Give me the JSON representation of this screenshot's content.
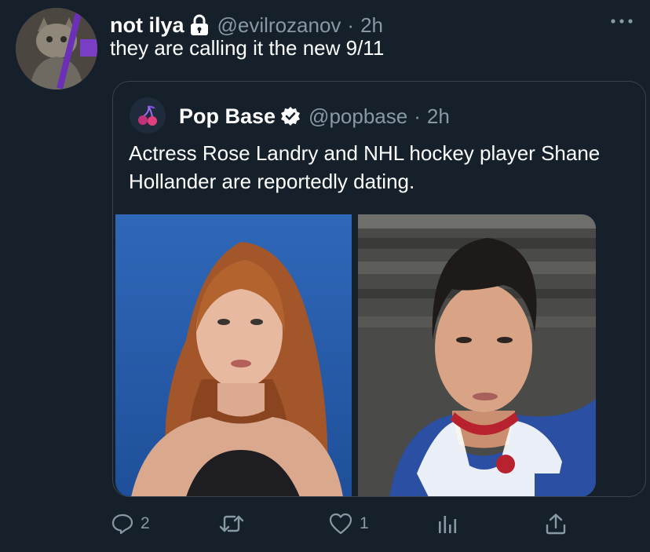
{
  "tweet": {
    "display_name": "not ilya",
    "handle": "@evilrozanov",
    "separator": "·",
    "time": "2h",
    "text": "they are calling it the new 9/11"
  },
  "quoted_tweet": {
    "display_name": "Pop Base",
    "handle": "@popbase",
    "separator": "·",
    "time": "2h",
    "text": "Actress Rose Landry and NHL hockey player Shane Hollander are reportedly dating.",
    "images": [
      {
        "subject": "woman with long auburn wavy hair against a blue background"
      },
      {
        "subject": "man with dark hair wearing a blue, white and red hockey jersey"
      }
    ]
  },
  "actions": {
    "reply_count": "2",
    "retweet_count": "",
    "like_count": "1"
  },
  "colors": {
    "background": "#15202b",
    "secondary_text": "#8899a6",
    "border": "#38444d",
    "verified": "#ffffff"
  },
  "icons": [
    "lock-icon",
    "more-icon",
    "verified-icon",
    "reply-icon",
    "retweet-icon",
    "like-icon",
    "analytics-icon",
    "share-icon"
  ]
}
